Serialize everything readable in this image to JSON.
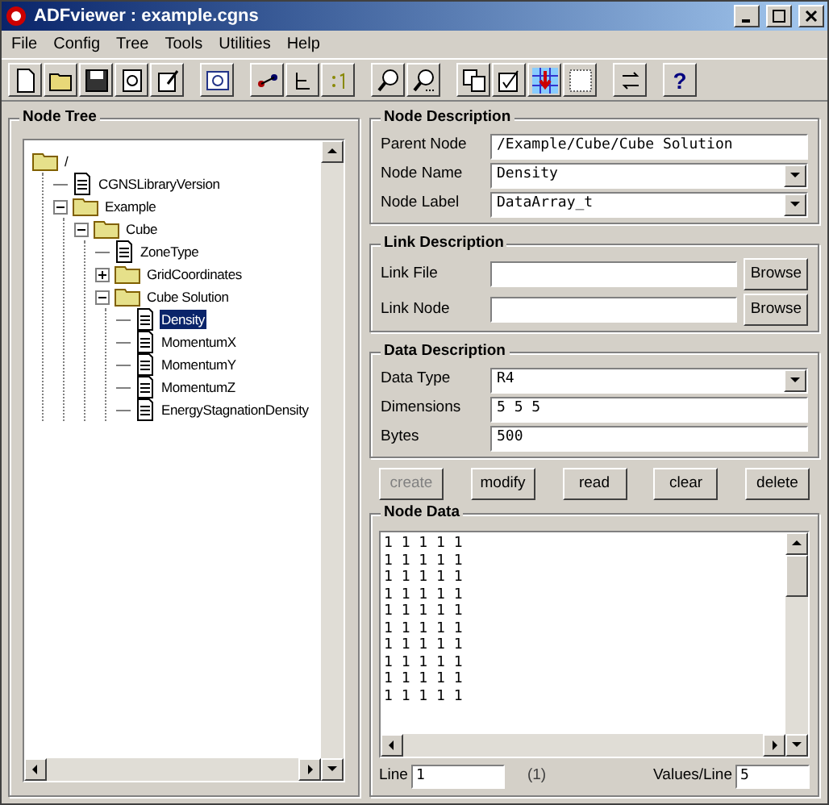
{
  "window": {
    "title": "ADFviewer : example.cgns"
  },
  "menu": [
    "File",
    "Config",
    "Tree",
    "Tools",
    "Utilities",
    "Help"
  ],
  "toolbar": [
    {
      "kind": "new"
    },
    {
      "kind": "open"
    },
    {
      "kind": "save"
    },
    {
      "kind": "refresh"
    },
    {
      "kind": "properties"
    },
    {
      "kind": "inspect"
    },
    {
      "kind": "nodeab"
    },
    {
      "kind": "nodetree"
    },
    {
      "kind": "index"
    },
    {
      "kind": "zoomin"
    },
    {
      "kind": "zoomout"
    },
    {
      "kind": "copy"
    },
    {
      "kind": "check"
    },
    {
      "kind": "grid"
    },
    {
      "kind": "select"
    },
    {
      "kind": "swap"
    },
    {
      "kind": "help",
      "label": "?"
    }
  ],
  "node_tree": {
    "title": "Node Tree",
    "nodes": [
      {
        "label": "/",
        "kind": "folder",
        "selected": false,
        "children": [
          {
            "label": "CGNSLibraryVersion",
            "kind": "file",
            "selected": false
          },
          {
            "label": "Example",
            "kind": "folder",
            "selected": false,
            "expanded": true,
            "children": [
              {
                "label": "Cube",
                "kind": "folder",
                "selected": false,
                "expanded": true,
                "children": [
                  {
                    "label": "ZoneType",
                    "kind": "file",
                    "selected": false
                  },
                  {
                    "label": "GridCoordinates",
                    "kind": "folder",
                    "selected": false,
                    "expanded": false
                  },
                  {
                    "label": "Cube Solution",
                    "kind": "folder",
                    "selected": false,
                    "expanded": true,
                    "children": [
                      {
                        "label": "Density",
                        "kind": "file",
                        "selected": true
                      },
                      {
                        "label": "MomentumX",
                        "kind": "file",
                        "selected": false
                      },
                      {
                        "label": "MomentumY",
                        "kind": "file",
                        "selected": false
                      },
                      {
                        "label": "MomentumZ",
                        "kind": "file",
                        "selected": false
                      },
                      {
                        "label": "EnergyStagnationDensity",
                        "kind": "file",
                        "selected": false
                      }
                    ]
                  }
                ]
              }
            ]
          }
        ]
      }
    ]
  },
  "node_description": {
    "title": "Node Description",
    "fields": [
      {
        "label": "Parent Node",
        "value": "/Example/Cube/Cube Solution",
        "kind": "text"
      },
      {
        "label": "Node Name",
        "value": "Density",
        "kind": "combo"
      },
      {
        "label": "Node Label",
        "value": "DataArray_t",
        "kind": "combo"
      }
    ]
  },
  "link_description": {
    "title": "Link Description",
    "fields": [
      {
        "label": "Link File",
        "button": "Browse"
      },
      {
        "label": "Link Node",
        "button": "Browse"
      }
    ]
  },
  "data_description": {
    "title": "Data Description",
    "fields": [
      {
        "label": "Data Type",
        "value": "R4",
        "kind": "combo"
      },
      {
        "label": "Dimensions",
        "value": "5 5 5",
        "kind": "text"
      },
      {
        "label": "Bytes",
        "value": "500",
        "kind": "text"
      }
    ]
  },
  "actions": [
    {
      "label": "create",
      "disabled": true
    },
    {
      "label": "modify",
      "disabled": false
    },
    {
      "label": "read",
      "disabled": false
    },
    {
      "label": "clear",
      "disabled": false
    },
    {
      "label": "delete",
      "disabled": false
    }
  ],
  "node_data": {
    "title": "Node Data",
    "lines": [
      "1 1 1 1 1",
      "1 1 1 1 1",
      "1 1 1 1 1",
      "1 1 1 1 1",
      "1 1 1 1 1",
      "1 1 1 1 1",
      "1 1 1 1 1",
      "1 1 1 1 1",
      "1 1 1 1 1",
      "1 1 1 1 1"
    ],
    "line_label": "Line",
    "line_value": "1",
    "line_count": "(1)",
    "values_label": "Values/Line",
    "values_value": "5"
  }
}
